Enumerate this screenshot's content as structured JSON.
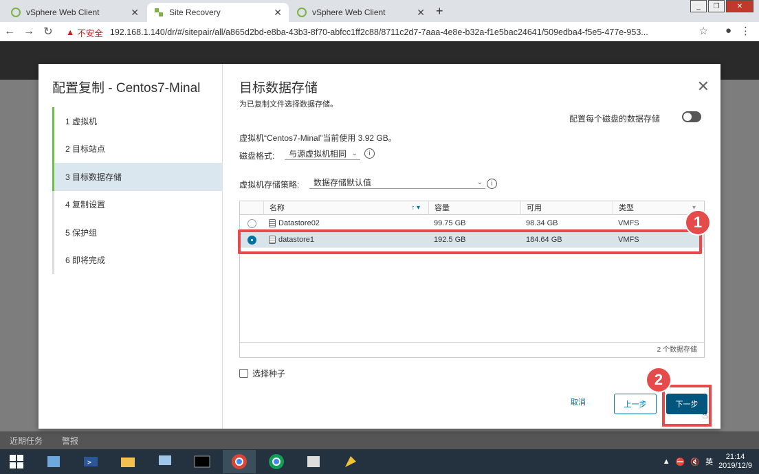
{
  "browser": {
    "tabs": [
      {
        "label": "vSphere Web Client",
        "active": false
      },
      {
        "label": "Site Recovery",
        "active": true
      },
      {
        "label": "vSphere Web Client",
        "active": false
      }
    ],
    "security_label": "不安全",
    "url": "192.168.1.140/dr/#/sitepair/all/a865d2bd-e8ba-43b3-8f70-abfcc1ff2c88/8711c2d7-7aaa-4e8e-b32a-f1e5bac24641/509edba4-f5e5-477e-953..."
  },
  "dialog": {
    "title": "配置复制 - Centos7-Minal",
    "steps": [
      {
        "label": "1  虚拟机",
        "state": "done"
      },
      {
        "label": "2  目标站点",
        "state": "done"
      },
      {
        "label": "3  目标数据存储",
        "state": "current"
      },
      {
        "label": "4  复制设置",
        "state": "todo"
      },
      {
        "label": "5  保护组",
        "state": "todo"
      },
      {
        "label": "6  即将完成",
        "state": "todo"
      }
    ],
    "page_title": "目标数据存储",
    "page_subtitle": "为已复制文件选择数据存储。",
    "per_disk_label": "配置每个磁盘的数据存储",
    "usage_text": "虚拟机“Centos7-Minal”当前使用 3.92 GB。",
    "disk_format_label": "磁盘格式:",
    "disk_format_value": "与源虚拟机相同",
    "policy_label": "虚拟机存储策略:",
    "policy_value": "数据存储默认值",
    "columns": [
      "名称",
      "容量",
      "可用",
      "类型"
    ],
    "rows": [
      {
        "name": "Datastore02",
        "capacity": "99.75 GB",
        "free": "98.34 GB",
        "type": "VMFS",
        "selected": false
      },
      {
        "name": "datastore1",
        "capacity": "192.5 GB",
        "free": "184.64 GB",
        "type": "VMFS",
        "selected": true
      }
    ],
    "footer_count": "2 个数据存储",
    "seed_label": "选择种子",
    "cancel": "取消",
    "back": "上一步",
    "next": "下一步"
  },
  "annotations": {
    "badge1": "1",
    "badge2": "2"
  },
  "bottom": {
    "recent_tasks": "近期任务",
    "alarms": "警报"
  },
  "taskbar": {
    "ime": "英",
    "time": "21:14",
    "date": "2019/12/9"
  },
  "colors": {
    "accent": "#0072a3",
    "annotation": "#e64b4b",
    "step_done": "#6ebd44",
    "next_button": "#00567d"
  }
}
